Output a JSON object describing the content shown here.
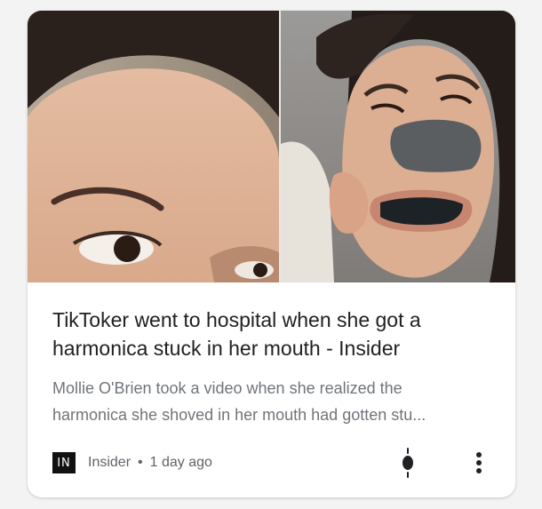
{
  "article": {
    "title": "TikToker went to hospital when she got a harmonica stuck in her mouth - Insider",
    "snippet_line1": "Mollie O'Brien took a video when she realized the",
    "snippet_line2": "harmonica she shoved in her mouth had gotten stu...",
    "source_logo_text": "IN",
    "source_name": "Insider",
    "separator": "•",
    "time_ago": "1 day ago"
  },
  "icons": {
    "related": "audio-level-icon",
    "more": "more-vert-icon"
  },
  "colors": {
    "title": "#202124",
    "snippet": "#70757a",
    "meta": "#5f6368",
    "card_bg": "#ffffff",
    "page_bg": "#f3f3f3"
  }
}
